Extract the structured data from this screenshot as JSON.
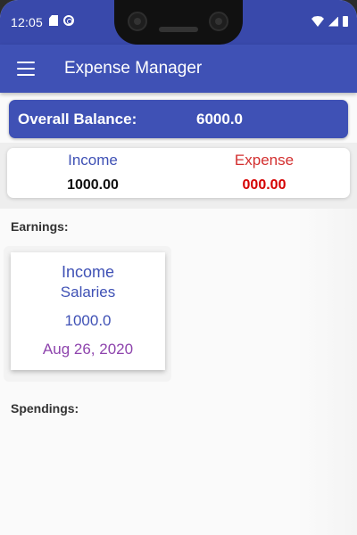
{
  "status_bar": {
    "time": "12:05",
    "icons_left": [
      "sd-card-icon",
      "sync-icon"
    ],
    "icons_right": [
      "wifi-icon",
      "signal-icon",
      "battery-icon"
    ]
  },
  "app_bar": {
    "title": "Expense Manager",
    "menu_icon": "menu-icon",
    "color": "#3f51b5"
  },
  "balance": {
    "label": "Overall Balance:",
    "value": "6000.0"
  },
  "summary": {
    "income_label": "Income",
    "income_value": "1000.00",
    "expense_label": "Expense",
    "expense_value": "000.00",
    "income_color": "#3f51b5",
    "expense_color": "#d32f2f"
  },
  "earnings": {
    "heading": "Earnings:",
    "items": [
      {
        "type": "Income",
        "category": "Salaries",
        "amount": "1000.0",
        "date": "Aug 26, 2020"
      }
    ]
  },
  "spendings": {
    "heading": "Spendings:"
  }
}
